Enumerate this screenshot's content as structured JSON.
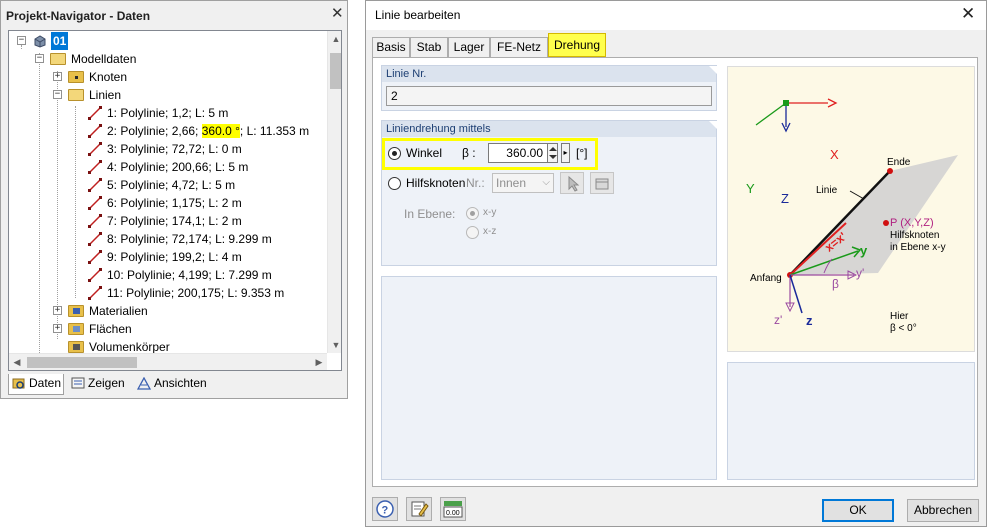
{
  "navigator": {
    "title": "Projekt-Navigator - Daten",
    "close": "✕",
    "root": "01",
    "tree": {
      "modelldaten": "Modelldaten",
      "knoten": "Knoten",
      "linien": "Linien",
      "lines": [
        {
          "text": "1: Polylinie; 1,2; L: 5 m"
        },
        {
          "pre": "2: Polylinie; 2,66; ",
          "hl": "360.0 °",
          "post": "; L: 11.353 m"
        },
        {
          "text": "3: Polylinie; 72,72; L: 0 m"
        },
        {
          "text": "4: Polylinie; 200,66; L: 5 m"
        },
        {
          "text": "5: Polylinie; 4,72; L: 5 m"
        },
        {
          "text": "6: Polylinie; 1,175; L: 2 m"
        },
        {
          "text": "7: Polylinie; 174,1; L: 2 m"
        },
        {
          "text": "8: Polylinie; 72,174; L: 9.299 m"
        },
        {
          "text": "9: Polylinie; 199,2; L: 4 m"
        },
        {
          "text": "10: Polylinie; 4,199; L: 7.299 m"
        },
        {
          "text": "11: Polylinie; 200,175; L: 9.353 m"
        }
      ],
      "materialien": "Materialien",
      "flaechen": "Flächen",
      "volumenkoerper": "Volumenkörper"
    },
    "tabs": [
      "Daten",
      "Zeigen",
      "Ansichten"
    ]
  },
  "dialog": {
    "title": "Linie bearbeiten",
    "close": "✕",
    "tabs": [
      "Basis",
      "Stab",
      "Lager",
      "FE-Netz",
      "Drehung"
    ],
    "active_tab": "Drehung",
    "linie_nr": {
      "label": "Linie Nr.",
      "value": "2"
    },
    "drehung": {
      "label": "Liniendrehung mittels",
      "winkel_label": "Winkel",
      "beta_label": "β :",
      "beta_value": "360.00",
      "unit": "[°]",
      "hilfsknoten_label": "Hilfsknoten",
      "nr_label": "Nr.:",
      "nr_value": "Innen",
      "ebene_label": "In Ebene:",
      "ebene_xy": "x-y",
      "ebene_xz": "x-z"
    },
    "figure": {
      "x": "X",
      "y": "Y",
      "z": "Z",
      "ende": "Ende",
      "linie": "Linie",
      "p_label": "P (X,Y,Z)",
      "hilfsknoten": "Hilfsknoten",
      "in_ebene": "in Ebene x-y",
      "anfang": "Anfang",
      "x_local": "x=x'",
      "y_local": "y",
      "y_prime": "y'",
      "beta": "β",
      "z_prime": "z'",
      "z_local": "z",
      "hier": "Hier",
      "beta_lt": "β < 0°"
    },
    "buttons": {
      "ok": "OK",
      "cancel": "Abbrechen"
    }
  },
  "colors": {
    "highlight": "#ffff00",
    "group_header": "#dbe3ee",
    "red": "#e02020",
    "green": "#1a9a1a",
    "blue": "#1a2a9a"
  }
}
